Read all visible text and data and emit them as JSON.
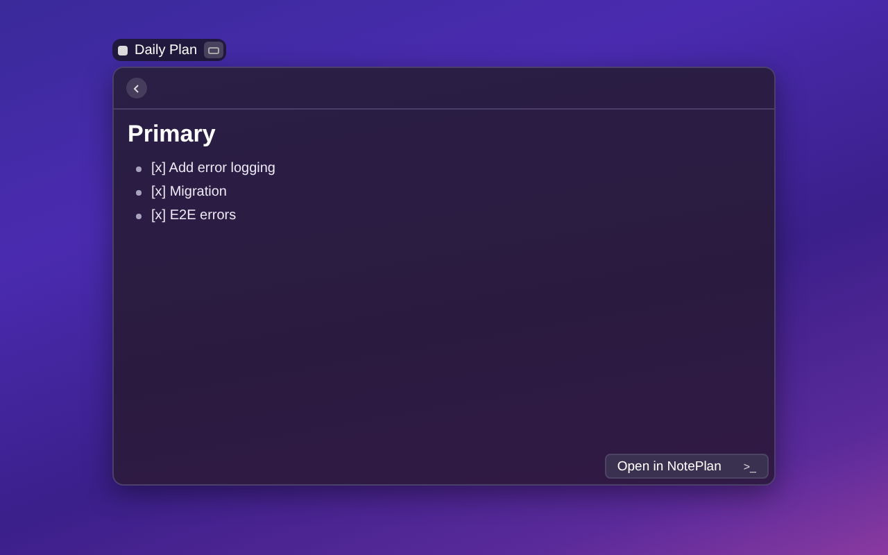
{
  "tag": {
    "label": "Daily Plan"
  },
  "note": {
    "heading": "Primary",
    "items": [
      {
        "text": "[x] Add error logging"
      },
      {
        "text": "[x] Migration"
      },
      {
        "text": "[x] E2E errors"
      }
    ]
  },
  "action": {
    "label": "Open in NotePlan",
    "shortcut": ">_"
  }
}
